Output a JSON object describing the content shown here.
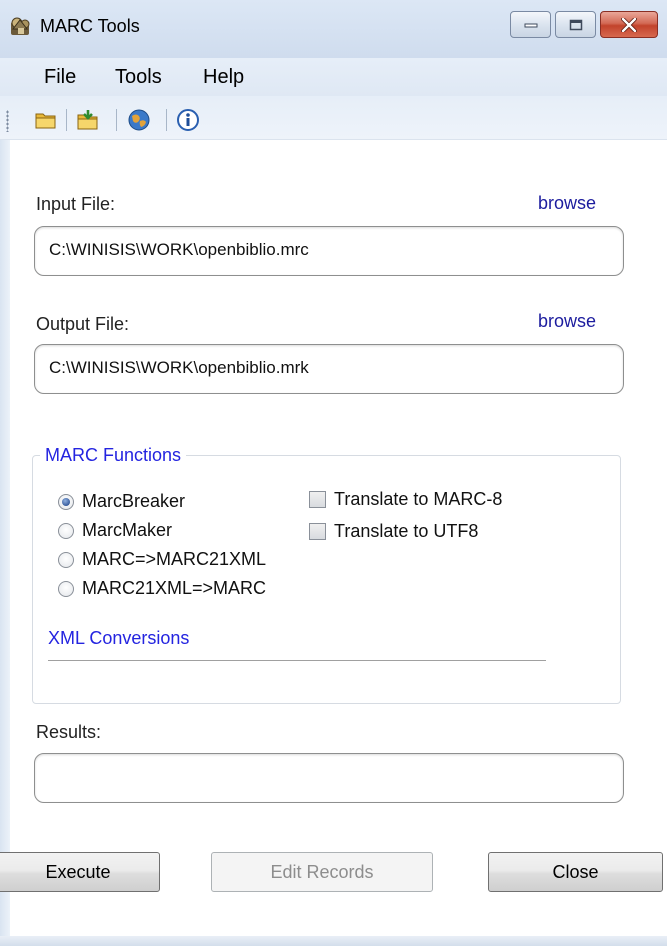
{
  "window": {
    "title": "MARC Tools"
  },
  "menu": {
    "items": [
      "File",
      "Tools",
      "Help"
    ]
  },
  "toolbar": {
    "buttons": [
      {
        "icon": "open-folder-icon"
      },
      {
        "icon": "save-folder-icon"
      },
      {
        "icon": "globe-icon"
      },
      {
        "icon": "info-icon"
      }
    ]
  },
  "input": {
    "label": "Input File:",
    "browse": "browse",
    "value": "C:\\WINISIS\\WORK\\openbiblio.mrc"
  },
  "output": {
    "label": "Output File:",
    "browse": "browse",
    "value": "C:\\WINISIS\\WORK\\openbiblio.mrk"
  },
  "marc_functions": {
    "title": "MARC Functions",
    "radios": [
      {
        "label": "MarcBreaker",
        "checked": true
      },
      {
        "label": "MarcMaker",
        "checked": false
      },
      {
        "label": "MARC=>MARC21XML",
        "checked": false
      },
      {
        "label": "MARC21XML=>MARC",
        "checked": false
      }
    ],
    "checkboxes": [
      {
        "label": "Translate to MARC-8",
        "checked": false
      },
      {
        "label": "Translate to UTF8",
        "checked": false
      }
    ],
    "xml_conversions": "XML Conversions"
  },
  "results": {
    "label": "Results:",
    "value": ""
  },
  "buttons": {
    "execute": "Execute",
    "edit_records": "Edit Records",
    "close": "Close"
  },
  "colors": {
    "group_title": "#2424e0",
    "link": "#1c1c9e",
    "title_bar": "#dce7f5"
  }
}
